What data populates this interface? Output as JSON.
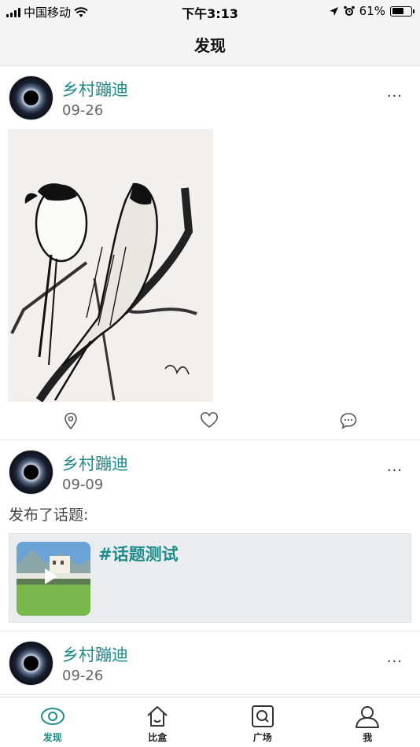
{
  "status_bar": {
    "carrier": "中国移动",
    "time": "下午3:13",
    "battery": "61%",
    "battery_level": 0.61
  },
  "header": {
    "title": "发现"
  },
  "posts": [
    {
      "author": "乡村蹦迪",
      "date": "09-26",
      "more": "···",
      "image_icon": "parrot-sketch-image",
      "actions": [
        "location-icon",
        "heart-icon",
        "comment-icon"
      ]
    },
    {
      "author": "乡村蹦迪",
      "date": "09-09",
      "more": "···",
      "text": "发布了话题:",
      "topic": {
        "title": "#话题测试",
        "thumb_icon": "video-play-icon"
      }
    },
    {
      "author": "乡村蹦迪",
      "date": "09-26",
      "more": "···"
    }
  ],
  "tab_bar": {
    "tabs": [
      {
        "label": "发现",
        "icon": "eye-icon",
        "active": true
      },
      {
        "label": "比盒",
        "icon": "home-icon",
        "active": false
      },
      {
        "label": "广场",
        "icon": "square-search-icon",
        "active": false
      },
      {
        "label": "我",
        "icon": "user-icon",
        "active": false
      }
    ]
  },
  "colors": {
    "accent": "#1d8c8a",
    "text": "#333333",
    "card_bg": "#e9edf0"
  }
}
